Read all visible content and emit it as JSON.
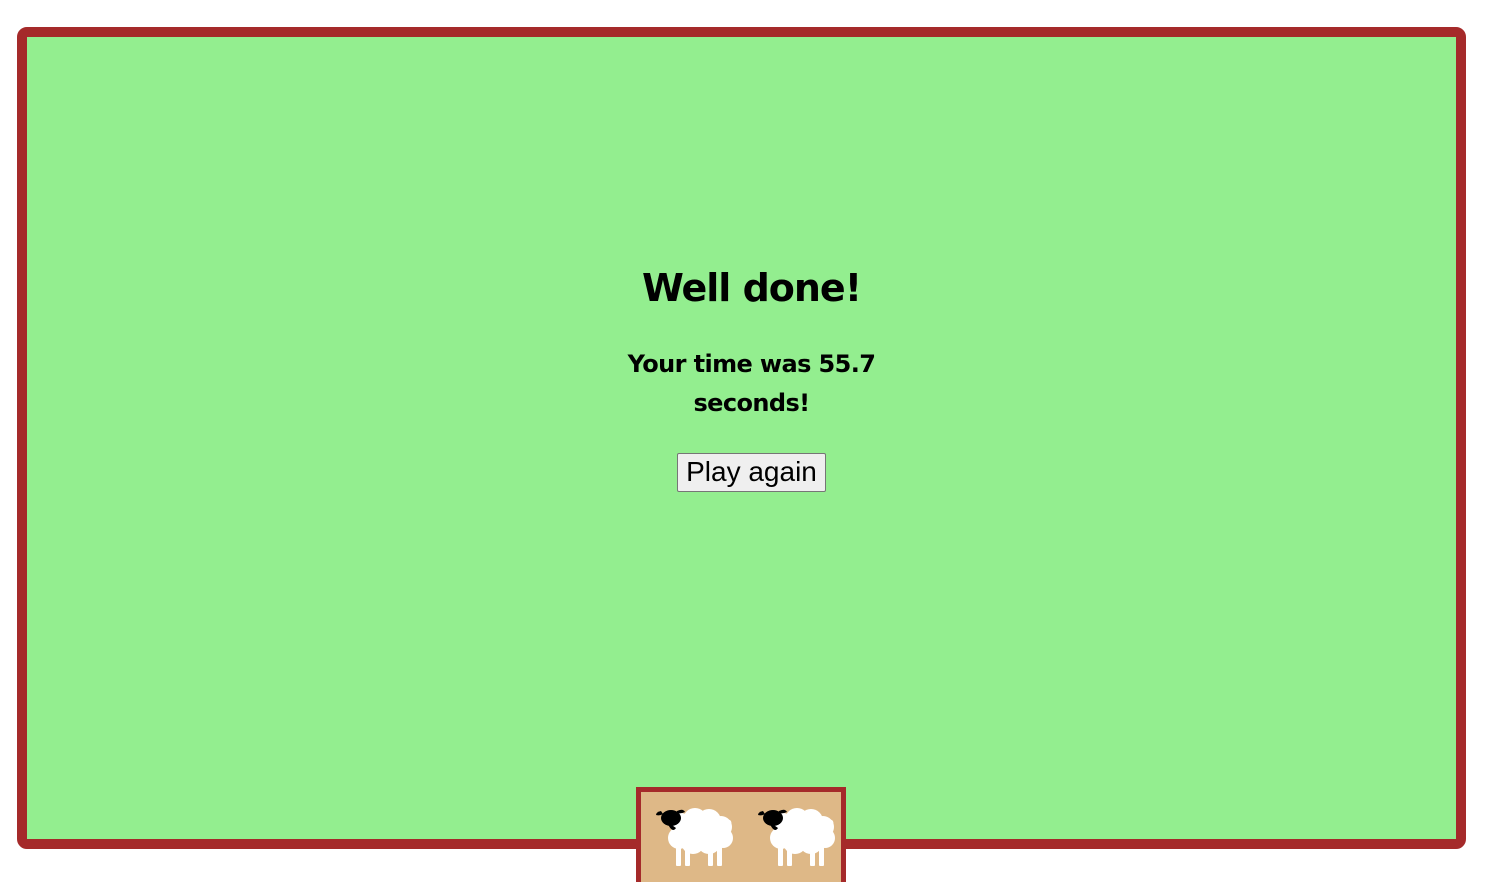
{
  "game": {
    "title": "Well done!",
    "result_text": "Your time was 55.7 seconds!",
    "time_seconds": 55.7,
    "play_again_label": "Play again"
  },
  "colors": {
    "field": "#93ee8f",
    "border": "#a52a2a",
    "pen": "#deb887",
    "sheep_body": "#ffffff",
    "sheep_head": "#000000"
  },
  "pen": {
    "sheep_count": 2,
    "sheep_icons": [
      "sheep-icon",
      "sheep-icon"
    ]
  }
}
